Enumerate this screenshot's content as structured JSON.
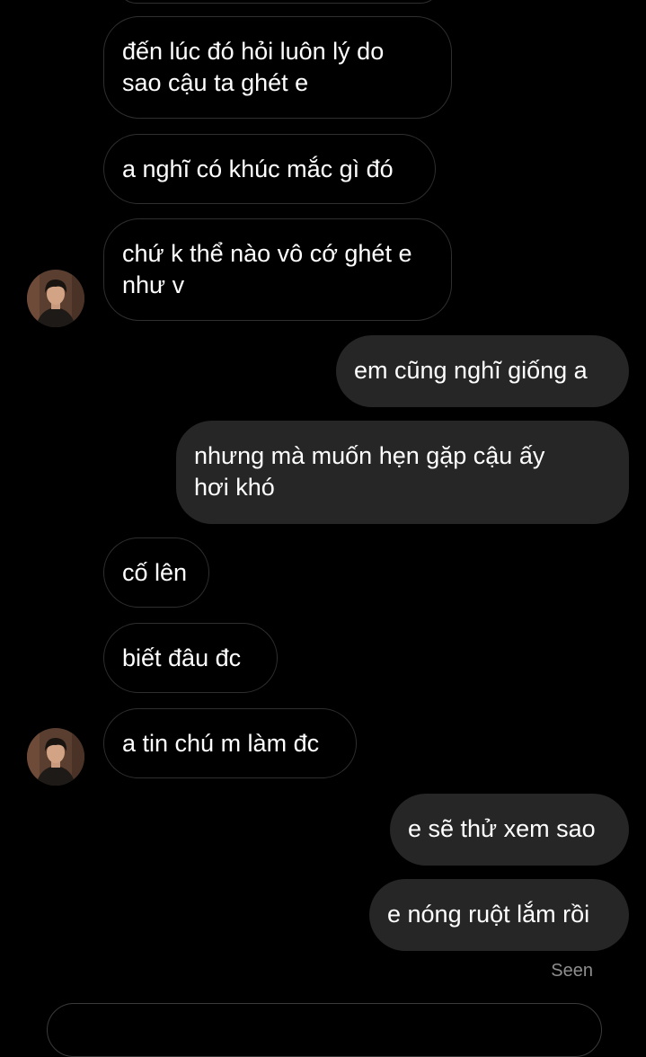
{
  "messages": [
    {
      "direction": "incoming",
      "text": "đến lúc đó hỏi luôn lý do\nsao cậu ta ghét e"
    },
    {
      "direction": "incoming",
      "text": "a nghĩ có khúc mắc gì đó"
    },
    {
      "direction": "incoming",
      "text": "chứ k thể nào vô cớ ghét e\nnhư v",
      "avatar": true
    },
    {
      "direction": "outgoing",
      "text": "em cũng nghĩ giống a"
    },
    {
      "direction": "outgoing",
      "text": "nhưng mà muốn hẹn gặp cậu ấy\nhơi khó"
    },
    {
      "direction": "incoming",
      "text": "cố lên"
    },
    {
      "direction": "incoming",
      "text": "biết đâu đc"
    },
    {
      "direction": "incoming",
      "text": "a tin chú m làm đc",
      "avatar": true
    },
    {
      "direction": "outgoing",
      "text": "e sẽ thử xem sao"
    },
    {
      "direction": "outgoing",
      "text": "e nóng ruột lắm rồi"
    }
  ],
  "status": {
    "seen": "Seen"
  },
  "colors": {
    "background": "#000000",
    "incoming_border": "#2f2f2f",
    "outgoing_bg": "#262626",
    "text": "#ffffff",
    "seen_text": "#8e8e8e"
  },
  "icons": {
    "avatar": "profile-photo"
  }
}
